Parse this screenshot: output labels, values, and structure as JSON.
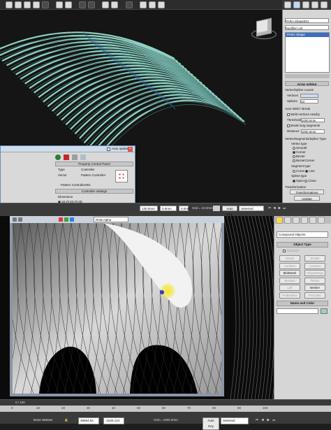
{
  "top_panel": {
    "object_name": "PARA Shape001",
    "modifier_list": "Modifier List",
    "stack_item": "PARA Shape",
    "array_settings": "Array setting",
    "vertex_spline_counts": "Vertex/Spline counts",
    "vertices_label": "Vertices",
    "splines_label": "Splines",
    "splines_value": "23",
    "auto_weld": "Auto Weld / Break",
    "weld_nearby": "Weld vertices nearby",
    "threshold_label": "Threshold",
    "threshold_value": "1000.0mm",
    "break_long": "Break long segments",
    "distance_label": "Distance",
    "distance_value": "1000.0mm",
    "vsp_type": "Vertex/Segments/Spline Type",
    "vertex_type": "Vertex type",
    "smooth": "Smooth",
    "corner": "Corner",
    "bezier": "Bezier",
    "bezier_corner": "BezierCorner",
    "segment_type": "Segment type",
    "curve": "Curve",
    "line": "Line",
    "spline_type": "Spline type",
    "open": "Open",
    "close": "Close",
    "transformation": "Transformation",
    "transformations_btn": "Transformations",
    "update_btn": "Update"
  },
  "controller_window": {
    "auto_update": "Auto update",
    "property_panel": "Property Control Panel",
    "type_label": "Type",
    "type_value": "Controller",
    "vector_label": "Vector",
    "vector_value": "Pattern Controller",
    "controller_name": "Pattern Controller001",
    "controller_settings": "Controller settings",
    "dimension": "Dimension",
    "dim_1d": "1D",
    "dim_2d": "2D",
    "dim_3d": "3D",
    "method_mapping": "Method of mapping"
  },
  "mid_bar": {
    "x_value": "130.0mm",
    "y_value": "0.0mm",
    "z_value": "0.0mm",
    "grid": "Grid = 10.0mm",
    "auto_key": "Auto Key",
    "selected": "Selected"
  },
  "render_window": {
    "channel": "RGB Alpha"
  },
  "bottom_panel": {
    "category": "Compound Objects",
    "object_type": "Object Type",
    "autogrid": "AutoGrid",
    "buttons": [
      {
        "label": "Morph",
        "enabled": false
      },
      {
        "label": "Scatter",
        "enabled": false
      },
      {
        "label": "Conform",
        "enabled": false
      },
      {
        "label": "Connect",
        "enabled": false
      },
      {
        "label": "BlobMesh",
        "enabled": true
      },
      {
        "label": "ShapeMerge",
        "enabled": false
      },
      {
        "label": "Boolean",
        "enabled": false
      },
      {
        "label": "Terrain",
        "enabled": false
      },
      {
        "label": "Loft",
        "enabled": false
      },
      {
        "label": "Mesher",
        "enabled": true
      },
      {
        "label": "ProBoolean",
        "enabled": false
      },
      {
        "label": "ProCutter",
        "enabled": false
      }
    ],
    "name_and_color": "Name and Color"
  },
  "bottom_status": {
    "frame_counter": "0 / 100",
    "ticks": [
      "0",
      "10",
      "20",
      "30",
      "40",
      "50",
      "60",
      "70",
      "80",
      "90",
      "100"
    ],
    "selection": "None Selecte",
    "x_value": "36964.84",
    "y_value": "-1525.124",
    "grid": "Grid = 1000.0mm",
    "auto_key": "Auto Key",
    "selected": "Selected"
  },
  "colors": {
    "viewport_bg": "#151515",
    "rib_color": "#8fd2c4",
    "shell_color": "#f2f2f2",
    "highlight_yellow": "#f5e63a"
  }
}
